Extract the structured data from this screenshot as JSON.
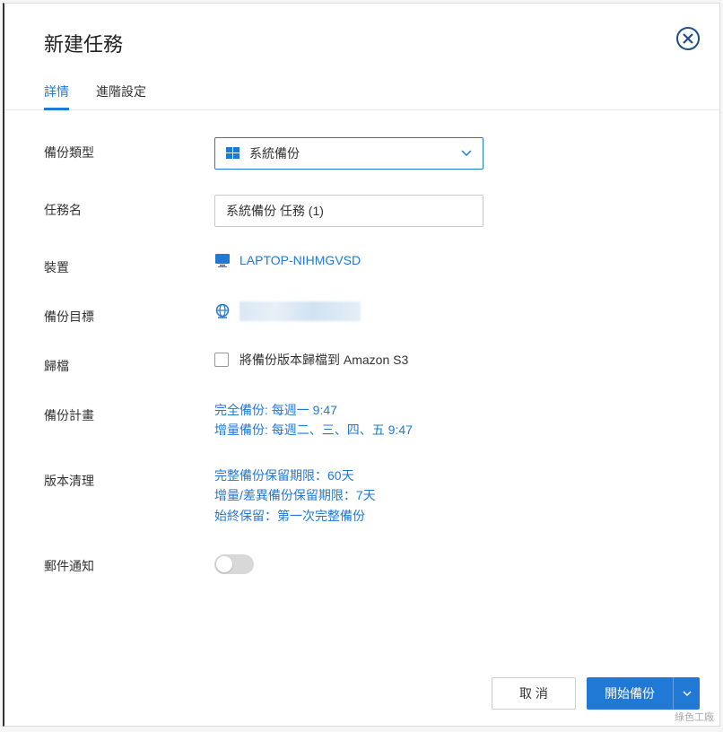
{
  "dialog": {
    "title": "新建任務",
    "tabs": [
      {
        "label": "詳情",
        "active": true
      },
      {
        "label": "進階設定",
        "active": false
      }
    ]
  },
  "fields": {
    "backup_type": {
      "label": "備份類型",
      "selected": "系統備份"
    },
    "task_name": {
      "label": "任務名",
      "value": "系統備份 任務 (1)"
    },
    "device": {
      "label": "裝置",
      "value": "LAPTOP-NIHMGVSD"
    },
    "target": {
      "label": "備份目標",
      "value": ""
    },
    "archive": {
      "label": "歸檔",
      "checkbox_label": "將備份版本歸檔到 Amazon S3",
      "checked": false
    },
    "schedule": {
      "label": "備份計畫",
      "lines": [
        "完全備份: 每週一 9:47",
        "增量備份: 每週二、三、四、五 9:47"
      ]
    },
    "cleanup": {
      "label": "版本清理",
      "lines": [
        "完整備份保留期限：60天",
        "增量/差異備份保留期限：7天",
        "始終保留：第一次完整備份"
      ]
    },
    "email": {
      "label": "郵件通知",
      "enabled": false
    }
  },
  "footer": {
    "cancel": "取 消",
    "start": "開始備份"
  },
  "watermark": "綠色工廠"
}
